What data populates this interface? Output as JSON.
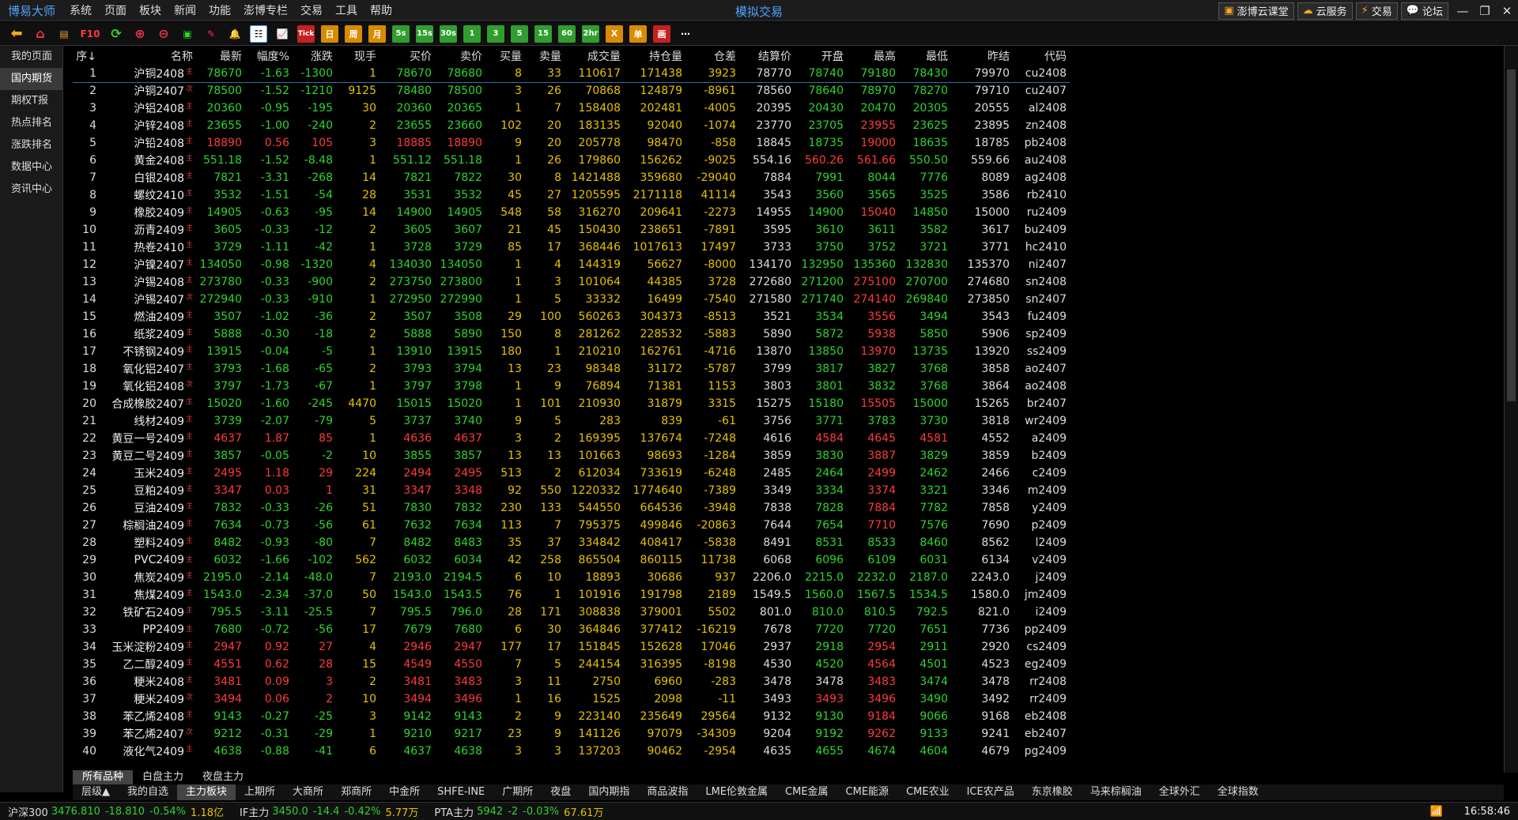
{
  "app": {
    "name": "博易大师",
    "center_title": "模拟交易",
    "menu": [
      "系统",
      "页面",
      "板块",
      "新闻",
      "功能",
      "澎博专栏",
      "交易",
      "工具",
      "帮助"
    ],
    "right_buttons": [
      "澎博云课堂",
      "云服务",
      "交易",
      "论坛"
    ]
  },
  "toolbar": {
    "f10": "F10",
    "tick": "Tick",
    "periods": [
      "日",
      "周",
      "月",
      "5s",
      "15s",
      "30s",
      "1",
      "3",
      "5",
      "15",
      "60",
      "2hr",
      "X",
      "单",
      "画"
    ],
    "more": "⋯"
  },
  "sidebar": [
    "我的页面",
    "国内期货",
    "期权T报",
    "热点排名",
    "涨跌排名",
    "数据中心",
    "资讯中心"
  ],
  "table": {
    "headers": [
      "序↓",
      "名称",
      "最新",
      "幅度%",
      "涨跌",
      "现手",
      "买价",
      "卖价",
      "买量",
      "卖量",
      "成交量",
      "持仓量",
      "仓差",
      "结算价",
      "开盘",
      "最高",
      "最低",
      "昨结",
      "代码"
    ],
    "rows": [
      [
        "1",
        "沪铜2408",
        "主",
        "78670",
        "-1.63",
        "-1300",
        "1",
        "78670",
        "78680",
        "8",
        "33",
        "110617",
        "171438",
        "3923",
        "78770",
        "78740",
        "79180",
        "78430",
        "79970",
        "cu2408"
      ],
      [
        "2",
        "沪铜2407",
        "次",
        "78500",
        "-1.52",
        "-1210",
        "9125",
        "78480",
        "78500",
        "3",
        "26",
        "70868",
        "124879",
        "-8961",
        "78560",
        "78640",
        "78970",
        "78270",
        "79710",
        "cu2407"
      ],
      [
        "3",
        "沪铝2408",
        "主",
        "20360",
        "-0.95",
        "-195",
        "30",
        "20360",
        "20365",
        "1",
        "7",
        "158408",
        "202481",
        "-4005",
        "20395",
        "20430",
        "20470",
        "20305",
        "20555",
        "al2408"
      ],
      [
        "4",
        "沪锌2408",
        "主",
        "23655",
        "-1.00",
        "-240",
        "2",
        "23655",
        "23660",
        "102",
        "20",
        "183135",
        "92040",
        "-1074",
        "23770",
        "23705",
        "23955",
        "23625",
        "23895",
        "zn2408"
      ],
      [
        "5",
        "沪铅2408",
        "主",
        "18890",
        "0.56",
        "105",
        "3",
        "18885",
        "18890",
        "9",
        "20",
        "205778",
        "98470",
        "-858",
        "18845",
        "18735",
        "19000",
        "18635",
        "18785",
        "pb2408"
      ],
      [
        "6",
        "黄金2408",
        "主",
        "551.18",
        "-1.52",
        "-8.48",
        "1",
        "551.12",
        "551.18",
        "1",
        "26",
        "179860",
        "156262",
        "-9025",
        "554.16",
        "560.26",
        "561.66",
        "550.50",
        "559.66",
        "au2408"
      ],
      [
        "7",
        "白银2408",
        "主",
        "7821",
        "-3.31",
        "-268",
        "14",
        "7821",
        "7822",
        "30",
        "8",
        "1421488",
        "359680",
        "-29040",
        "7884",
        "7991",
        "8044",
        "7776",
        "8089",
        "ag2408"
      ],
      [
        "8",
        "螺纹2410",
        "主",
        "3532",
        "-1.51",
        "-54",
        "28",
        "3531",
        "3532",
        "45",
        "27",
        "1205595",
        "2171118",
        "41114",
        "3543",
        "3560",
        "3565",
        "3525",
        "3586",
        "rb2410"
      ],
      [
        "9",
        "橡胶2409",
        "主",
        "14905",
        "-0.63",
        "-95",
        "14",
        "14900",
        "14905",
        "548",
        "58",
        "316270",
        "209641",
        "-2273",
        "14955",
        "14900",
        "15040",
        "14850",
        "15000",
        "ru2409"
      ],
      [
        "10",
        "沥青2409",
        "主",
        "3605",
        "-0.33",
        "-12",
        "2",
        "3605",
        "3607",
        "21",
        "45",
        "150430",
        "238651",
        "-7891",
        "3595",
        "3610",
        "3611",
        "3582",
        "3617",
        "bu2409"
      ],
      [
        "11",
        "热卷2410",
        "主",
        "3729",
        "-1.11",
        "-42",
        "1",
        "3728",
        "3729",
        "85",
        "17",
        "368446",
        "1017613",
        "17497",
        "3733",
        "3750",
        "3752",
        "3721",
        "3771",
        "hc2410"
      ],
      [
        "12",
        "沪镍2407",
        "主",
        "134050",
        "-0.98",
        "-1320",
        "4",
        "134030",
        "134050",
        "1",
        "4",
        "144319",
        "56627",
        "-8000",
        "134170",
        "132950",
        "135360",
        "132830",
        "135370",
        "ni2407"
      ],
      [
        "13",
        "沪锡2408",
        "主",
        "273780",
        "-0.33",
        "-900",
        "2",
        "273750",
        "273800",
        "1",
        "3",
        "101064",
        "44385",
        "3728",
        "272680",
        "271200",
        "275100",
        "270700",
        "274680",
        "sn2408"
      ],
      [
        "14",
        "沪锡2407",
        "次",
        "272940",
        "-0.33",
        "-910",
        "1",
        "272950",
        "272990",
        "1",
        "5",
        "33332",
        "16499",
        "-7540",
        "271580",
        "271740",
        "274140",
        "269840",
        "273850",
        "sn2407"
      ],
      [
        "15",
        "燃油2409",
        "主",
        "3507",
        "-1.02",
        "-36",
        "2",
        "3507",
        "3508",
        "29",
        "100",
        "560263",
        "304373",
        "-8513",
        "3521",
        "3534",
        "3556",
        "3494",
        "3543",
        "fu2409"
      ],
      [
        "16",
        "纸浆2409",
        "主",
        "5888",
        "-0.30",
        "-18",
        "2",
        "5888",
        "5890",
        "150",
        "8",
        "281262",
        "228532",
        "-5883",
        "5890",
        "5872",
        "5938",
        "5850",
        "5906",
        "sp2409"
      ],
      [
        "17",
        "不锈钢2409",
        "主",
        "13915",
        "-0.04",
        "-5",
        "1",
        "13910",
        "13915",
        "180",
        "1",
        "210210",
        "162761",
        "-4716",
        "13870",
        "13850",
        "13970",
        "13735",
        "13920",
        "ss2409"
      ],
      [
        "18",
        "氧化铝2407",
        "主",
        "3793",
        "-1.68",
        "-65",
        "2",
        "3793",
        "3794",
        "13",
        "23",
        "98348",
        "31172",
        "-5787",
        "3799",
        "3817",
        "3827",
        "3768",
        "3858",
        "ao2407"
      ],
      [
        "19",
        "氧化铝2408",
        "次",
        "3797",
        "-1.73",
        "-67",
        "1",
        "3797",
        "3798",
        "1",
        "9",
        "76894",
        "71381",
        "1153",
        "3803",
        "3801",
        "3832",
        "3768",
        "3864",
        "ao2408"
      ],
      [
        "20",
        "合成橡胶2407",
        "主",
        "15020",
        "-1.60",
        "-245",
        "4470",
        "15015",
        "15020",
        "1",
        "101",
        "210930",
        "31879",
        "3315",
        "15275",
        "15180",
        "15505",
        "15000",
        "15265",
        "br2407"
      ],
      [
        "21",
        "线材2409",
        "主",
        "3739",
        "-2.07",
        "-79",
        "5",
        "3737",
        "3740",
        "9",
        "5",
        "283",
        "839",
        "-61",
        "3756",
        "3771",
        "3783",
        "3730",
        "3818",
        "wr2409"
      ],
      [
        "22",
        "黄豆一号2409",
        "主",
        "4637",
        "1.87",
        "85",
        "1",
        "4636",
        "4637",
        "3",
        "2",
        "169395",
        "137674",
        "-7248",
        "4616",
        "4584",
        "4645",
        "4581",
        "4552",
        "a2409"
      ],
      [
        "23",
        "黄豆二号2409",
        "主",
        "3857",
        "-0.05",
        "-2",
        "10",
        "3855",
        "3857",
        "13",
        "13",
        "101663",
        "98693",
        "-1284",
        "3859",
        "3830",
        "3887",
        "3829",
        "3859",
        "b2409"
      ],
      [
        "24",
        "玉米2409",
        "主",
        "2495",
        "1.18",
        "29",
        "224",
        "2494",
        "2495",
        "513",
        "2",
        "612034",
        "733619",
        "-6248",
        "2485",
        "2464",
        "2499",
        "2462",
        "2466",
        "c2409"
      ],
      [
        "25",
        "豆粕2409",
        "主",
        "3347",
        "0.03",
        "1",
        "31",
        "3347",
        "3348",
        "92",
        "550",
        "1220332",
        "1774640",
        "-7389",
        "3349",
        "3334",
        "3374",
        "3321",
        "3346",
        "m2409"
      ],
      [
        "26",
        "豆油2409",
        "主",
        "7832",
        "-0.33",
        "-26",
        "51",
        "7830",
        "7832",
        "230",
        "133",
        "544550",
        "664536",
        "-3948",
        "7838",
        "7828",
        "7884",
        "7782",
        "7858",
        "y2409"
      ],
      [
        "27",
        "棕榈油2409",
        "主",
        "7634",
        "-0.73",
        "-56",
        "61",
        "7632",
        "7634",
        "113",
        "7",
        "795375",
        "499846",
        "-20863",
        "7644",
        "7654",
        "7710",
        "7576",
        "7690",
        "p2409"
      ],
      [
        "28",
        "塑料2409",
        "主",
        "8482",
        "-0.93",
        "-80",
        "7",
        "8482",
        "8483",
        "35",
        "37",
        "334842",
        "408417",
        "-5838",
        "8491",
        "8531",
        "8533",
        "8460",
        "8562",
        "l2409"
      ],
      [
        "29",
        "PVC2409",
        "主",
        "6032",
        "-1.66",
        "-102",
        "562",
        "6032",
        "6034",
        "42",
        "258",
        "865504",
        "860115",
        "11738",
        "6068",
        "6096",
        "6109",
        "6031",
        "6134",
        "v2409"
      ],
      [
        "30",
        "焦炭2409",
        "主",
        "2195.0",
        "-2.14",
        "-48.0",
        "7",
        "2193.0",
        "2194.5",
        "6",
        "10",
        "18893",
        "30686",
        "937",
        "2206.0",
        "2215.0",
        "2232.0",
        "2187.0",
        "2243.0",
        "j2409"
      ],
      [
        "31",
        "焦煤2409",
        "主",
        "1543.0",
        "-2.34",
        "-37.0",
        "50",
        "1543.0",
        "1543.5",
        "76",
        "1",
        "101916",
        "191798",
        "2189",
        "1549.5",
        "1560.0",
        "1567.5",
        "1534.5",
        "1580.0",
        "jm2409"
      ],
      [
        "32",
        "铁矿石2409",
        "主",
        "795.5",
        "-3.11",
        "-25.5",
        "7",
        "795.5",
        "796.0",
        "28",
        "171",
        "308838",
        "379001",
        "5502",
        "801.0",
        "810.0",
        "810.5",
        "792.5",
        "821.0",
        "i2409"
      ],
      [
        "33",
        "PP2409",
        "主",
        "7680",
        "-0.72",
        "-56",
        "17",
        "7679",
        "7680",
        "6",
        "30",
        "364846",
        "377412",
        "-16219",
        "7678",
        "7720",
        "7720",
        "7651",
        "7736",
        "pp2409"
      ],
      [
        "34",
        "玉米淀粉2409",
        "主",
        "2947",
        "0.92",
        "27",
        "4",
        "2946",
        "2947",
        "177",
        "17",
        "151845",
        "152628",
        "17046",
        "2937",
        "2918",
        "2954",
        "2911",
        "2920",
        "cs2409"
      ],
      [
        "35",
        "乙二醇2409",
        "主",
        "4551",
        "0.62",
        "28",
        "15",
        "4549",
        "4550",
        "7",
        "5",
        "244154",
        "316395",
        "-8198",
        "4530",
        "4520",
        "4564",
        "4501",
        "4523",
        "eg2409"
      ],
      [
        "36",
        "粳米2408",
        "主",
        "3481",
        "0.09",
        "3",
        "2",
        "3481",
        "3483",
        "3",
        "11",
        "2750",
        "6960",
        "-283",
        "3478",
        "3478",
        "3483",
        "3474",
        "3478",
        "rr2408"
      ],
      [
        "37",
        "粳米2409",
        "次",
        "3494",
        "0.06",
        "2",
        "10",
        "3494",
        "3496",
        "1",
        "16",
        "1525",
        "2098",
        "-11",
        "3493",
        "3493",
        "3496",
        "3490",
        "3492",
        "rr2409"
      ],
      [
        "38",
        "苯乙烯2408",
        "主",
        "9143",
        "-0.27",
        "-25",
        "3",
        "9142",
        "9143",
        "2",
        "9",
        "223140",
        "235649",
        "29564",
        "9132",
        "9130",
        "9184",
        "9066",
        "9168",
        "eb2408"
      ],
      [
        "39",
        "苯乙烯2407",
        "次",
        "9212",
        "-0.31",
        "-29",
        "1",
        "9210",
        "9217",
        "23",
        "9",
        "141126",
        "97079",
        "-34309",
        "9204",
        "9192",
        "9262",
        "9133",
        "9241",
        "eb2407"
      ],
      [
        "40",
        "液化气2409",
        "主",
        "4638",
        "-0.88",
        "-41",
        "6",
        "4637",
        "4638",
        "3",
        "3",
        "137203",
        "90462",
        "-2954",
        "4635",
        "4655",
        "4674",
        "4604",
        "4679",
        "pg2409"
      ]
    ]
  },
  "tabs_top": [
    "所有品种",
    "白盘主力",
    "夜盘主力"
  ],
  "tabs_bottom": [
    "层级▲",
    "我的自选",
    "主力板块",
    "上期所",
    "大商所",
    "郑商所",
    "中金所",
    "SHFE-INE",
    "广期所",
    "夜盘",
    "国内期指",
    "商品波指",
    "LME伦敦金属",
    "CME金属",
    "CME能源",
    "CME农业",
    "ICE农产品",
    "东京橡胶",
    "马来棕榈油",
    "全球外汇",
    "全球指数"
  ],
  "status": {
    "hs300_label": "沪深300",
    "hs300_val": "3476.810",
    "hs300_chg": "-18.810",
    "hs300_pct": "-0.54%",
    "hs300_amt": "1.18亿",
    "if_label": "IF主力",
    "if_val": "3450.0",
    "if_chg": "-14.4",
    "if_pct": "-0.42%",
    "if_amt": "5.77万",
    "pta_label": "PTA主力",
    "pta_val": "5942",
    "pta_chg": "-2",
    "pta_pct": "-0.03%",
    "pta_amt": "67.61万",
    "time": "16:58:46"
  }
}
